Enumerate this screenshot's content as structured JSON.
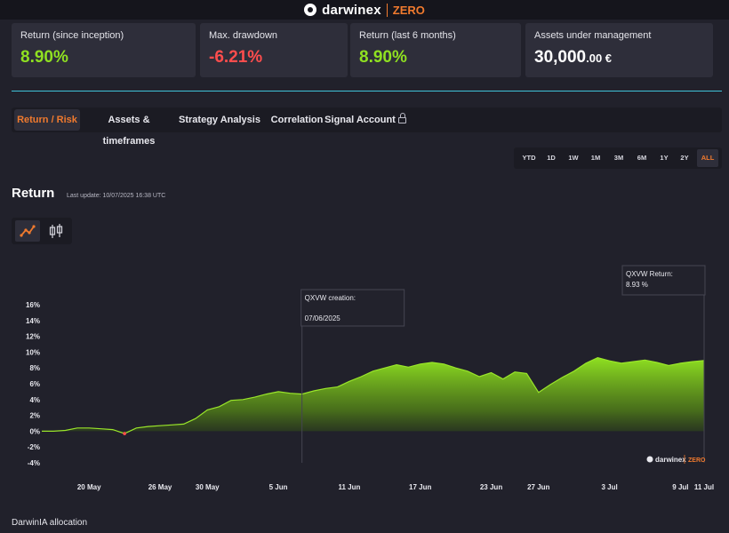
{
  "header": {
    "brand_name": "darwinex",
    "brand_sub": "ZERO"
  },
  "cards": [
    {
      "label": "Return (since inception)",
      "value": "8.90%",
      "suffix": ""
    },
    {
      "label": "Max. drawdown",
      "value": "-6.21%",
      "suffix": ""
    },
    {
      "label": "Return (last 6 months)",
      "value": "8.90%",
      "suffix": ""
    },
    {
      "label": "Assets under management",
      "value": "30,000",
      "suffix": ".00 €"
    }
  ],
  "tabs": [
    {
      "label": "Return / Risk",
      "active": true
    },
    {
      "label": "Assets & timeframes",
      "active": false
    },
    {
      "label": "Strategy Analysis",
      "active": false
    },
    {
      "label": "Correlation",
      "active": false
    },
    {
      "label": "Signal Account",
      "active": false,
      "icon": "lock-icon"
    }
  ],
  "ranges": [
    {
      "label": "YTD",
      "active": false
    },
    {
      "label": "1D",
      "active": false
    },
    {
      "label": "1W",
      "active": false
    },
    {
      "label": "1M",
      "active": false
    },
    {
      "label": "3M",
      "active": false
    },
    {
      "label": "6M",
      "active": false
    },
    {
      "label": "1Y",
      "active": false
    },
    {
      "label": "2Y",
      "active": false
    },
    {
      "label": "ALL",
      "active": true
    }
  ],
  "section": {
    "title": "Return",
    "last_update": "Last update: 10/07/2025 16:38 UTC"
  },
  "chart_types": [
    {
      "icon": "line-chart-icon",
      "active": true
    },
    {
      "icon": "candlestick-icon",
      "active": false
    }
  ],
  "colors": {
    "accent": "#f07a2e",
    "positive": "#8fe021",
    "negative": "#ff4d4d",
    "divider": "#3fc2d8"
  },
  "chart_data": {
    "type": "area",
    "x": [
      "16 May",
      "17 May",
      "18 May",
      "19 May",
      "20 May",
      "21 May",
      "22 May",
      "23 May",
      "24 May",
      "25 May",
      "26 May",
      "27 May",
      "28 May",
      "29 May",
      "30 May",
      "31 May",
      "1 Jun",
      "2 Jun",
      "3 Jun",
      "4 Jun",
      "5 Jun",
      "6 Jun",
      "7 Jun",
      "8 Jun",
      "9 Jun",
      "10 Jun",
      "11 Jun",
      "12 Jun",
      "13 Jun",
      "14 Jun",
      "15 Jun",
      "16 Jun",
      "17 Jun",
      "18 Jun",
      "19 Jun",
      "20 Jun",
      "21 Jun",
      "22 Jun",
      "23 Jun",
      "24 Jun",
      "25 Jun",
      "26 Jun",
      "27 Jun",
      "28 Jun",
      "29 Jun",
      "30 Jun",
      "1 Jul",
      "2 Jul",
      "3 Jul",
      "4 Jul",
      "5 Jul",
      "6 Jul",
      "7 Jul",
      "8 Jul",
      "9 Jul",
      "10 Jul",
      "11 Jul"
    ],
    "values": [
      0.0,
      0.0,
      0.1,
      0.4,
      0.4,
      0.3,
      0.2,
      -0.3,
      0.4,
      0.6,
      0.7,
      0.8,
      0.9,
      1.6,
      2.7,
      3.1,
      3.9,
      4.0,
      4.3,
      4.7,
      5.0,
      4.8,
      4.7,
      5.1,
      5.4,
      5.6,
      6.3,
      6.9,
      7.6,
      8.0,
      8.4,
      8.1,
      8.5,
      8.7,
      8.5,
      8.0,
      7.6,
      6.9,
      7.4,
      6.6,
      7.5,
      7.3,
      4.9,
      5.9,
      6.8,
      7.6,
      8.6,
      9.3,
      8.9,
      8.6,
      8.8,
      9.0,
      8.7,
      8.3,
      8.6,
      8.8,
      8.93
    ],
    "xticks": [
      "20 May",
      "26 May",
      "30 May",
      "5 Jun",
      "11 Jun",
      "17 Jun",
      "23 Jun",
      "27 Jun",
      "3 Jul",
      "9 Jul",
      "11 Jul"
    ],
    "xtick_positions": [
      "20 May",
      "26 May",
      "30 May",
      "5 Jun",
      "11 Jun",
      "17 Jun",
      "23 Jun",
      "27 Jun",
      "3 Jul",
      "9 Jul",
      "11 Jul"
    ],
    "yticks": [
      "16%",
      "14%",
      "12%",
      "10%",
      "8%",
      "6%",
      "4%",
      "2%",
      "0%",
      "-2%",
      "-4%"
    ],
    "ytick_values": [
      16,
      14,
      12,
      10,
      8,
      6,
      4,
      2,
      0,
      -2,
      -4
    ],
    "ylim": [
      -4,
      16
    ],
    "annotations": [
      {
        "title": "QXVW creation:",
        "value": "07/06/2025",
        "at": "7 Jun"
      },
      {
        "title": "QXVW Return:",
        "value": "8.93 %",
        "at": "11 Jul"
      }
    ],
    "watermark": {
      "name": "darwinex",
      "sub": "ZERO"
    }
  },
  "footer": {
    "label": "DarwinIA allocation"
  }
}
